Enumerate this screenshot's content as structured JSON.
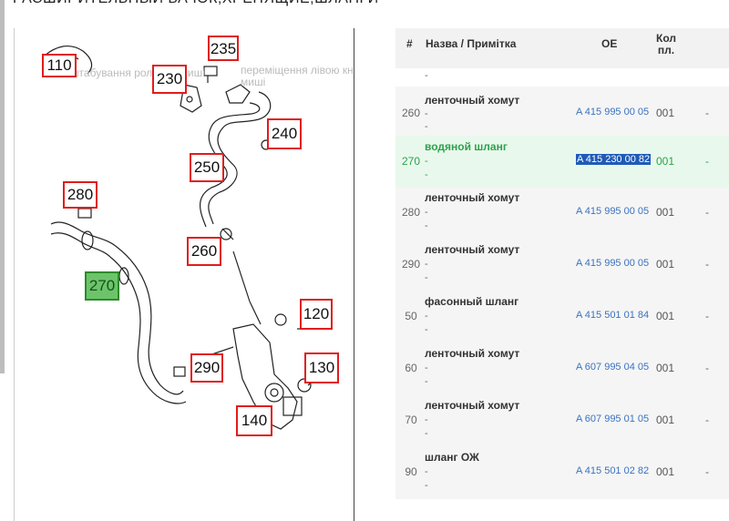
{
  "page_title": "РАСШИРИТЕЛЬНЫЙ БАЧОК,ХРЕНЯЩИЕ,ШЛАНГИ",
  "diagram": {
    "hint_zoom": "масштабування роликом миші",
    "hint_move": "переміщення лівою кнопкою миші",
    "callouts": [
      "110",
      "230",
      "235",
      "240",
      "250",
      "280",
      "260",
      "270",
      "120",
      "290",
      "130",
      "140"
    ],
    "active_callout": "270"
  },
  "table": {
    "headers": {
      "num": "#",
      "name": "Назва / Примітка",
      "oe": "OE",
      "qty": "Кол пл."
    },
    "top_note": "-",
    "rows": [
      {
        "num": "260",
        "name": "ленточный хомут",
        "note1": "-",
        "note2": "-",
        "oe": "A 415 995 00 05",
        "qty": "001",
        "dash": "-"
      },
      {
        "num": "270",
        "name": "водяной шланг",
        "note1": "-",
        "note2": "-",
        "oe": "A 415 230 00 82",
        "qty": "001",
        "dash": "-",
        "selected": true
      },
      {
        "num": "280",
        "name": "ленточный хомут",
        "note1": "-",
        "note2": "-",
        "oe": "A 415 995 00 05",
        "qty": "001",
        "dash": "-"
      },
      {
        "num": "290",
        "name": "ленточный хомут",
        "note1": "-",
        "note2": "-",
        "oe": "A 415 995 00 05",
        "qty": "001",
        "dash": "-"
      },
      {
        "num": "50",
        "name": "фасонный шланг",
        "note1": "-",
        "note2": "-",
        "oe": "A 415 501 01 84",
        "qty": "001",
        "dash": "-"
      },
      {
        "num": "60",
        "name": "ленточный хомут",
        "note1": "-",
        "note2": "-",
        "oe": "A 607 995 04 05",
        "qty": "001",
        "dash": "-"
      },
      {
        "num": "70",
        "name": "ленточный хомут",
        "note1": "-",
        "note2": "-",
        "oe": "A 607 995 01 05",
        "qty": "001",
        "dash": "-"
      },
      {
        "num": "90",
        "name": "шланг ОЖ",
        "note1": "-",
        "note2": "-",
        "oe": "A 415 501 02 82",
        "qty": "001",
        "dash": "-"
      }
    ]
  }
}
